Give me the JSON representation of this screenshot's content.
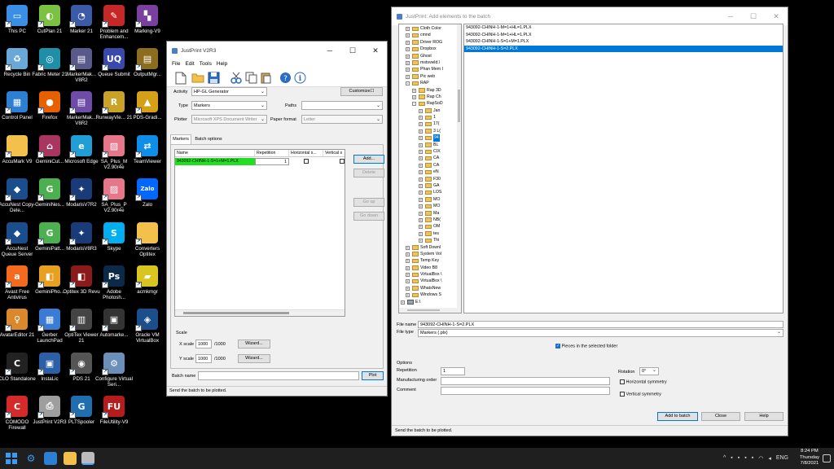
{
  "desktop": {
    "icons": [
      {
        "label": "This PC",
        "icon": "this-pc-icon",
        "color": "#3a8ee6",
        "glyph": "▭"
      },
      {
        "label": "Recycle Bin",
        "icon": "recycle-bin-icon",
        "color": "#6aa8d8",
        "glyph": "♻"
      },
      {
        "label": "Control Panel",
        "icon": "control-panel-icon",
        "color": "#2d7fd3",
        "glyph": "▦"
      },
      {
        "label": "AccuMark V9",
        "icon": "folder-icon",
        "color": "#f2c04b",
        "glyph": ""
      },
      {
        "label": "AccuNest Copy-Dele...",
        "icon": "accunest-icon",
        "color": "#1a4d8c",
        "glyph": "◆"
      },
      {
        "label": "AccuNest Queue Server",
        "icon": "accunest-icon",
        "color": "#1a4d8c",
        "glyph": "◆"
      },
      {
        "label": "Avast Free Antivirus",
        "icon": "avast-icon",
        "color": "#f46a1f",
        "glyph": "a"
      },
      {
        "label": "AvatarEditor 21",
        "icon": "avatar-editor-icon",
        "color": "#d9882b",
        "glyph": "♀"
      },
      {
        "label": "CLO Standalone",
        "icon": "clo-icon",
        "color": "#222222",
        "glyph": "C"
      },
      {
        "label": "COMODO Firewall",
        "icon": "comodo-icon",
        "color": "#d42a2a",
        "glyph": "C"
      },
      {
        "label": "CutPlan 21",
        "icon": "cutplan-icon",
        "color": "#7cc242",
        "glyph": "◐"
      },
      {
        "label": "Fabric Meter 21",
        "icon": "fabric-meter-icon",
        "color": "#1f8fa8",
        "glyph": "◎"
      },
      {
        "label": "Firefox",
        "icon": "firefox-icon",
        "color": "#e66000",
        "glyph": "●"
      },
      {
        "label": "GeminiCut...",
        "icon": "gemini-cut-icon",
        "color": "#a8365f",
        "glyph": "⌂"
      },
      {
        "label": "GeminiNes...",
        "icon": "gemini-nest-icon",
        "color": "#4caf50",
        "glyph": "G"
      },
      {
        "label": "GeminiPatt...",
        "icon": "gemini-pattern-icon",
        "color": "#4caf50",
        "glyph": "G"
      },
      {
        "label": "GeminiPho...",
        "icon": "gemini-photo-icon",
        "color": "#e8a020",
        "glyph": "◧"
      },
      {
        "label": "Gerber LaunchPad",
        "icon": "gerber-launchpad-icon",
        "color": "#3a7bd5",
        "glyph": "▦"
      },
      {
        "label": "InstaLic",
        "icon": "instalic-icon",
        "color": "#2b5fa6",
        "glyph": "▣"
      },
      {
        "label": "JustPrint V2R3",
        "icon": "printer-icon",
        "color": "#9e9e9e",
        "glyph": "⎙"
      },
      {
        "label": "Marker 21",
        "icon": "marker-icon",
        "color": "#3b5aa8",
        "glyph": "◔"
      },
      {
        "label": "MarkerMak... V8R2",
        "icon": "marker-maker-icon",
        "color": "#5a5a8a",
        "glyph": "▤"
      },
      {
        "label": "MarkerMak... V8R2",
        "icon": "marker-maker-icon",
        "color": "#6f4ca8",
        "glyph": "▤"
      },
      {
        "label": "Microsoft Edge",
        "icon": "edge-icon",
        "color": "#1f9fd6",
        "glyph": "e"
      },
      {
        "label": "ModarisV7R2",
        "icon": "modaris-icon",
        "color": "#1a3b7a",
        "glyph": "✦"
      },
      {
        "label": "ModarisV8R3",
        "icon": "modaris-icon",
        "color": "#1a3b7a",
        "glyph": "✦"
      },
      {
        "label": "Optitex 3D Revu",
        "icon": "optitex-icon",
        "color": "#8b1a1a",
        "glyph": "◧"
      },
      {
        "label": "OptiTex Viewer 21",
        "icon": "optitex-viewer-icon",
        "color": "#444444",
        "glyph": "▥"
      },
      {
        "label": "PDS 21",
        "icon": "pds-icon",
        "color": "#555555",
        "glyph": "◉"
      },
      {
        "label": "PLTSpooler",
        "icon": "plt-spooler-icon",
        "color": "#1f6fb0",
        "glyph": "G"
      },
      {
        "label": "Problem and Enhancem...",
        "icon": "problem-enhancement-icon",
        "color": "#c62828",
        "glyph": "✎"
      },
      {
        "label": "Queue Submit",
        "icon": "queue-submit-icon",
        "color": "#3949ab",
        "glyph": "UQ"
      },
      {
        "label": "RunwayVie... 21",
        "icon": "runway-viewer-icon",
        "color": "#c9a227",
        "glyph": "R"
      },
      {
        "label": "SA_Plus_M V2.90r4e",
        "icon": "sa-plus-icon",
        "color": "#e8768a",
        "glyph": "▨"
      },
      {
        "label": "SA_Plus_P V2.90r4e",
        "icon": "sa-plus-icon",
        "color": "#e8768a",
        "glyph": "▨"
      },
      {
        "label": "Skype",
        "icon": "skype-icon",
        "color": "#00aff0",
        "glyph": "S"
      },
      {
        "label": "Adobe Photosh...",
        "icon": "photoshop-icon",
        "color": "#0b2a4a",
        "glyph": "Ps"
      },
      {
        "label": "Automarke...",
        "icon": "automarker-icon",
        "color": "#333333",
        "glyph": "▣"
      },
      {
        "label": "Configure Virtual Seri...",
        "icon": "configure-virtual-serial-icon",
        "color": "#6a8fb8",
        "glyph": "⚙"
      },
      {
        "label": "FileUtility-V9",
        "icon": "file-utility-icon",
        "color": "#b71c1c",
        "glyph": "FU"
      },
      {
        "label": "Marking-V9",
        "icon": "marking-icon",
        "color": "#7b3fa0",
        "glyph": "▚"
      },
      {
        "label": "OutputMgr...",
        "icon": "output-manager-icon",
        "color": "#8c6d1f",
        "glyph": "▤"
      },
      {
        "label": "PDS-Gradi...",
        "icon": "pds-grading-icon",
        "color": "#d4a017",
        "glyph": "▲"
      },
      {
        "label": "TeamViewer",
        "icon": "teamviewer-icon",
        "color": "#0e8ee9",
        "glyph": "⇄"
      },
      {
        "label": "Zalo",
        "icon": "zalo-icon",
        "color": "#0068ff",
        "glyph": "Zalo"
      },
      {
        "label": "Converters Optitex",
        "icon": "folder-icon",
        "color": "#f2c04b",
        "glyph": ""
      },
      {
        "label": "acmkmgr",
        "icon": "acmkmgr-icon",
        "color": "#d8c520",
        "glyph": "▰"
      },
      {
        "label": "Oracle VM VirtualBox",
        "icon": "virtualbox-icon",
        "color": "#1b4f8c",
        "glyph": "◈"
      }
    ]
  },
  "justprint": {
    "title": "JustPrint V2R3",
    "menu": [
      "File",
      "Edit",
      "Tools",
      "Help"
    ],
    "activity_label": "Activity",
    "activity_value": "HP-GL Generator",
    "customize_label": "Customize",
    "type_label": "Type",
    "type_value": "Markers",
    "paths_label": "Paths",
    "plotter_label": "Plotter",
    "plotter_value": "Microsoft XPS Document Writer",
    "paper_format_label": "Paper format",
    "paper_format_value": "Letter",
    "tabs": [
      "Markers",
      "Batch options"
    ],
    "table_headers": [
      "Name",
      "Repetition",
      "Horizontal s...",
      "Vertical s"
    ],
    "table_rows": [
      {
        "name": "943092-CHINH-1-S=1+M=1.PLX",
        "repetition": "1"
      }
    ],
    "add_label": "Add...",
    "delete_label": "Delete",
    "go_up_label": "Go up",
    "go_down_label": "Go down",
    "scale_label": "Scale",
    "x_scale_label": "X scale",
    "x_scale_value": "1000",
    "x_scale_den": "/1000",
    "y_scale_label": "Y scale",
    "y_scale_value": "1000",
    "y_scale_den": "/1000",
    "wizard_label": "Wizard...",
    "batch_name_label": "Batch name",
    "plot_label": "Plot",
    "status": "Send the batch to be plotted.",
    "row_highlight": "#22dd22"
  },
  "add_dialog": {
    "title": "JustPrint: Add elements to the batch",
    "tree": [
      {
        "level": 0,
        "pm": "+",
        "label": "Cloth Color"
      },
      {
        "level": 0,
        "pm": "+",
        "label": "cmnd"
      },
      {
        "level": 0,
        "pm": "+",
        "label": "Driver ROG"
      },
      {
        "level": 0,
        "pm": "+",
        "label": "Dropbox"
      },
      {
        "level": 0,
        "pm": "+",
        "label": "Ghost"
      },
      {
        "level": 0,
        "pm": "+",
        "label": "mstsvwld.\\"
      },
      {
        "level": 0,
        "pm": "+",
        "label": "Phan Mem I"
      },
      {
        "level": 0,
        "pm": "+",
        "label": "Pic web"
      },
      {
        "level": 0,
        "pm": "-",
        "label": "RAP"
      },
      {
        "level": 1,
        "pm": "+",
        "label": "Rap 3D"
      },
      {
        "level": 1,
        "pm": "+",
        "label": "Rap Ch"
      },
      {
        "level": 1,
        "pm": "-",
        "label": "RapSoD"
      },
      {
        "level": 2,
        "pm": "+",
        "label": "Jan"
      },
      {
        "level": 2,
        "pm": "+",
        "label": "1"
      },
      {
        "level": 2,
        "pm": "+",
        "label": "17("
      },
      {
        "level": 2,
        "pm": "+",
        "label": "3 L("
      },
      {
        "level": 2,
        "pm": "+",
        "label": "94",
        "selected": true
      },
      {
        "level": 2,
        "pm": "+",
        "label": "BL"
      },
      {
        "level": 2,
        "pm": "+",
        "label": "CIX"
      },
      {
        "level": 2,
        "pm": "+",
        "label": "CA"
      },
      {
        "level": 2,
        "pm": "+",
        "label": "CA"
      },
      {
        "level": 2,
        "pm": "+",
        "label": "eN"
      },
      {
        "level": 2,
        "pm": "+",
        "label": "F30"
      },
      {
        "level": 2,
        "pm": "+",
        "label": "GA"
      },
      {
        "level": 2,
        "pm": "+",
        "label": "LOS"
      },
      {
        "level": 2,
        "pm": "+",
        "label": "MO"
      },
      {
        "level": 2,
        "pm": "+",
        "label": "MO"
      },
      {
        "level": 2,
        "pm": "+",
        "label": "Ma"
      },
      {
        "level": 2,
        "pm": "+",
        "label": "NB("
      },
      {
        "level": 2,
        "pm": "+",
        "label": "OM"
      },
      {
        "level": 2,
        "pm": "+",
        "label": "tes"
      },
      {
        "level": 2,
        "pm": "+",
        "label": "Thi"
      },
      {
        "level": 0,
        "pm": "+",
        "label": "Soft Downl"
      },
      {
        "level": 0,
        "pm": "+",
        "label": "System Vol"
      },
      {
        "level": 0,
        "pm": "+",
        "label": "Temp Key"
      },
      {
        "level": 0,
        "pm": "+",
        "label": "Video B8"
      },
      {
        "level": 0,
        "pm": "+",
        "label": "VirtualBox \\"
      },
      {
        "level": 0,
        "pm": "+",
        "label": "VirtualBox \\"
      },
      {
        "level": 0,
        "pm": "+",
        "label": "WhatsNew"
      },
      {
        "level": 0,
        "pm": "+",
        "label": "Windows S"
      },
      {
        "level": -1,
        "pm": "+",
        "label": "E:\\"
      }
    ],
    "files": [
      {
        "name": "943092-CHINH-1-M=1+HL=1.PLX",
        "selected": false
      },
      {
        "name": "943092-CHINH-1-M=1+HL=1.PLX",
        "selected": false
      },
      {
        "name": "943092-CHINH-1-S=1+M=1.PLX",
        "selected": false
      },
      {
        "name": "943092-CHINH-1-S=2.PLX",
        "selected": true
      }
    ],
    "file_name_label": "File name",
    "file_name_value": "943092-CHINH-1-S=2.PLX",
    "file_type_label": "File type",
    "file_type_value": "Markers (.plx)",
    "pieces_label": "Pieces in the selected folder",
    "options_label": "Options",
    "repetition_label": "Repetition",
    "repetition_value": "1",
    "manufacturing_order_label": "Manufacturing order",
    "comment_label": "Comment",
    "rotation_label": "Rotation",
    "rotation_value": "0°",
    "horizontal_symmetry_label": "Horizontal symmetry",
    "vertical_symmetry_label": "Vertical symmetry",
    "add_to_batch_label": "Add to batch",
    "close_label": "Close",
    "help_label": "Help",
    "status": "Send the batch to be plotted."
  },
  "taskbar": {
    "time": "8:24 PM",
    "day": "Thursday",
    "date": "7/8/2021",
    "lang": "ENG"
  }
}
